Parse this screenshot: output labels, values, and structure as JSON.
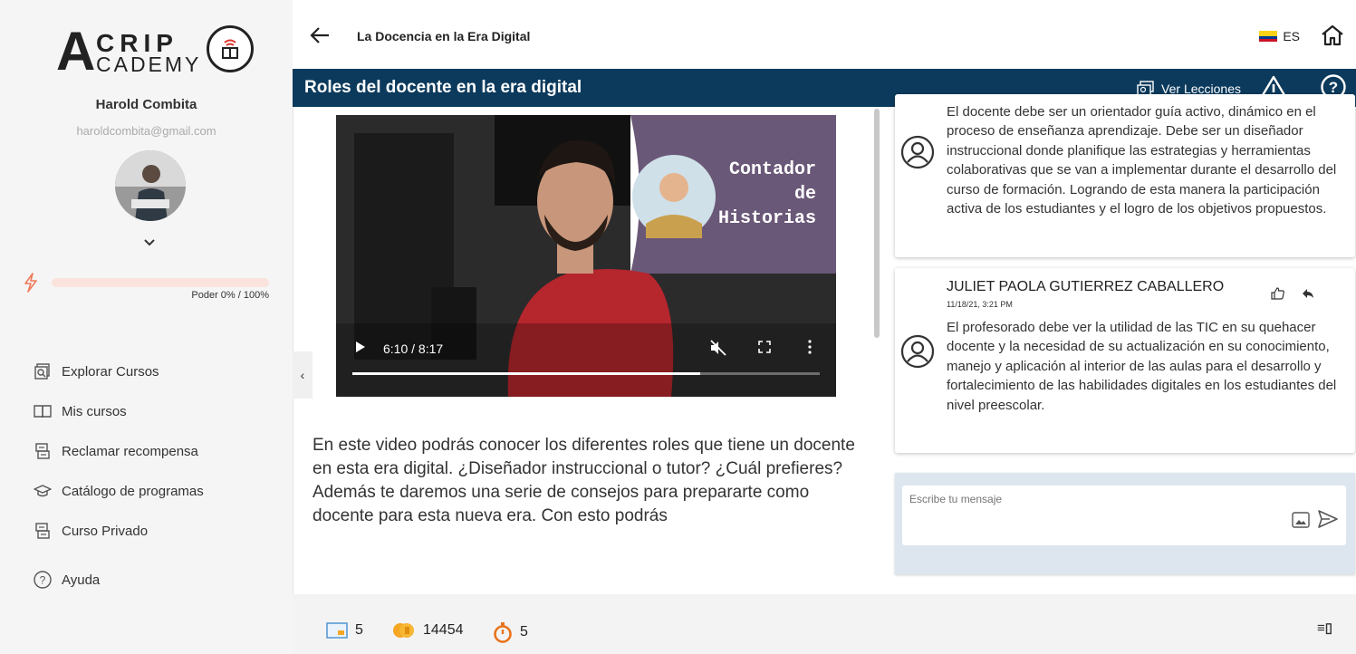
{
  "sidebar": {
    "logo_big": "A",
    "logo_top": "CRIP",
    "logo_bottom": "CADEMY",
    "user_name": "Harold Combita",
    "user_email": "haroldcombita@gmail.com",
    "power_label": "Poder 0% / 100%",
    "power_value": 0,
    "menu": [
      {
        "label": "Explorar Cursos",
        "icon": "explore-courses-icon"
      },
      {
        "label": "Mis cursos",
        "icon": "book-icon"
      },
      {
        "label": "Reclamar recompensa",
        "icon": "reward-icon"
      },
      {
        "label": "Catálogo de programas",
        "icon": "graduation-cap-icon"
      },
      {
        "label": "Curso Privado",
        "icon": "private-course-icon"
      },
      {
        "label": "Ayuda",
        "icon": "help-circle-icon"
      }
    ],
    "collapse_glyph": "‹"
  },
  "header": {
    "course_title": "La Docencia en la Era Digital",
    "lang": "ES"
  },
  "lesson": {
    "title": "Roles del docente en la era digital",
    "lessons_button": "Ver Lecciones"
  },
  "video": {
    "overlay_line1": "Contador",
    "overlay_line2": "de",
    "overlay_line3": "Historias",
    "time": "6:10 / 8:17",
    "progress": 0.744
  },
  "description": "En este video podrás conocer los diferentes roles que tiene un docente en esta era digital. ¿Diseñador instruccional o tutor? ¿Cuál prefieres? Además te daremos una serie de consejos para prepararte como docente para esta nueva era. Con esto podrás",
  "comments": [
    {
      "author": "",
      "date": "",
      "text": "El docente debe ser un orientador guía activo, dinámico en el proceso de enseñanza aprendizaje. Debe ser un diseñador instruccional donde planifique las estrategias y herramientas colaborativas que se van a implementar durante el desarrollo del curso de formación. Logrando de esta manera la participación activa de los estudiantes y el logro de los objetivos propuestos."
    },
    {
      "author": "JULIET PAOLA GUTIERREZ CABALLERO",
      "date": "11/18/21, 3:21 PM",
      "text": "El profesorado debe ver la utilidad de las TIC en su quehacer docente y la necesidad de su actualización en su conocimiento, manejo y aplicación al interior de las aulas para el desarrollo y fortalecimiento de las habilidades digitales en los estudiantes del nivel preescolar."
    }
  ],
  "chat": {
    "placeholder": "Escribe tu mensaje"
  },
  "footer": {
    "lessons_count": "5",
    "coins": "14454",
    "timer_count": "5",
    "list_glyph": "≡▯"
  },
  "colors": {
    "lesson_bar": "#0c3a5c",
    "power_track": "#fbe3dd",
    "power_icon": "#f07a5a",
    "coin": "#f5a623",
    "timer": "#e8731c"
  }
}
